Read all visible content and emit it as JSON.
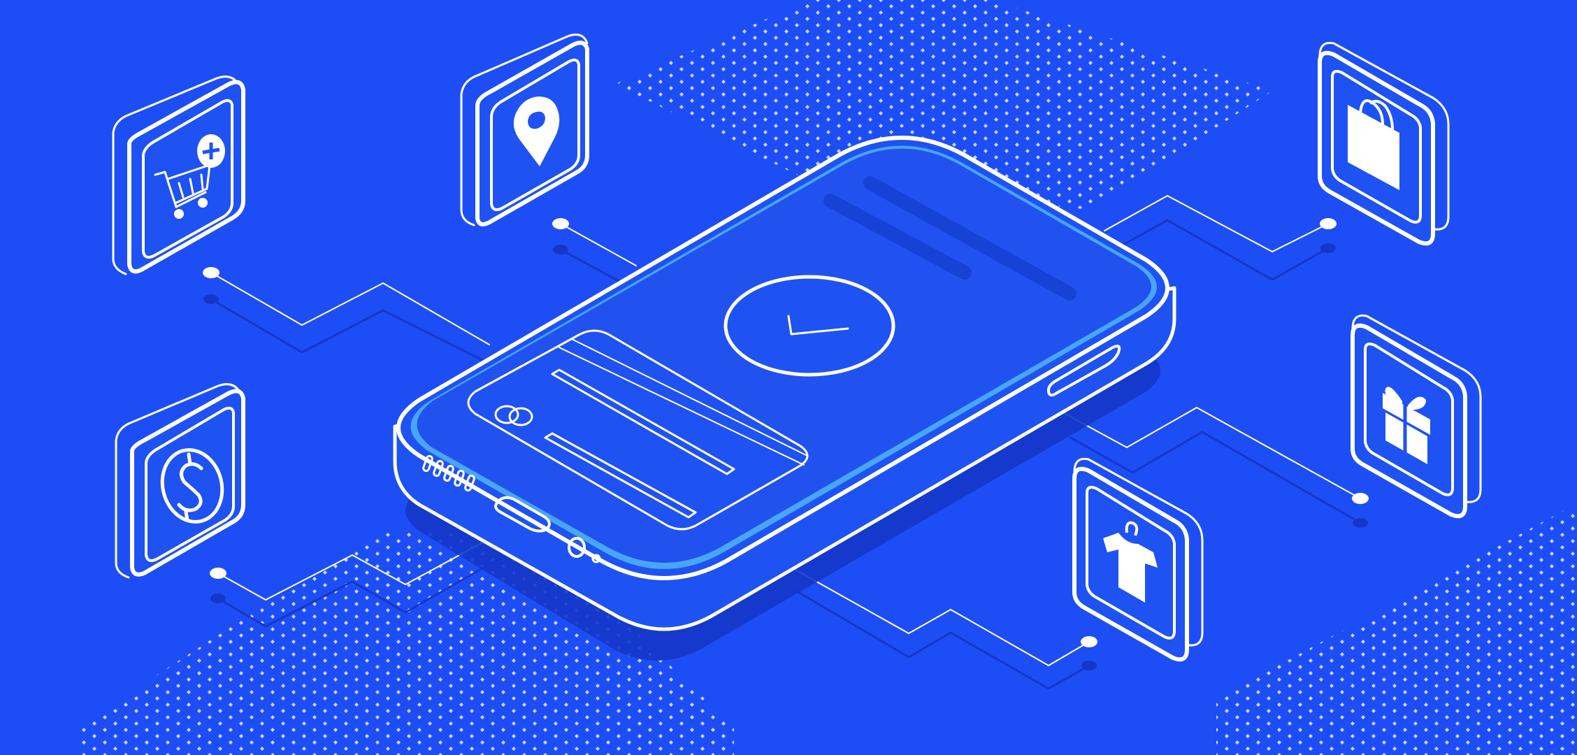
{
  "colors": {
    "background": "#1d4ef5",
    "shadow": "#1537c9",
    "phone_body": "#1f52f3",
    "screen": "#2152f0",
    "screen_rim": "#47a6f5",
    "bar": "#1742d6",
    "dots": "#ffffff",
    "line": "#ffffff"
  },
  "icons": [
    {
      "name": "shopping-cart-add-icon"
    },
    {
      "name": "location-pin-icon"
    },
    {
      "name": "shopping-bag-icon"
    },
    {
      "name": "dollar-coin-icon"
    },
    {
      "name": "gift-box-icon"
    },
    {
      "name": "tshirt-on-hanger-icon"
    }
  ],
  "phone_icons": [
    {
      "name": "checkmark-icon"
    },
    {
      "name": "card-chip-icon"
    }
  ]
}
